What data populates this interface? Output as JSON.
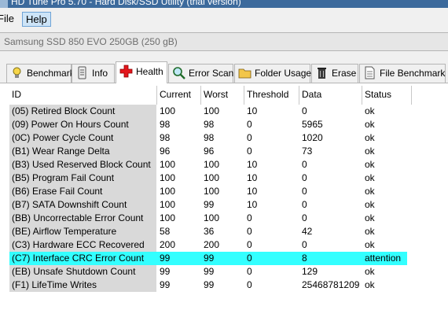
{
  "window": {
    "title": "HD Tune Pro 5.70 - Hard Disk/SSD Utility (trial version)"
  },
  "menu": {
    "file": "File",
    "help": "Help"
  },
  "drive": {
    "selected": "Samsung SSD 850 EVO 250GB (250 gB)"
  },
  "tabs": [
    {
      "label": "Benchmark",
      "icon": "lightbulb-icon"
    },
    {
      "label": "Info",
      "icon": "info-icon"
    },
    {
      "label": "Health",
      "icon": "health-cross-icon",
      "active": true
    },
    {
      "label": "Error Scan",
      "icon": "magnifier-icon"
    },
    {
      "label": "Folder Usage",
      "icon": "folder-icon"
    },
    {
      "label": "Erase",
      "icon": "trash-icon"
    },
    {
      "label": "File Benchmark",
      "icon": "file-icon"
    }
  ],
  "table": {
    "columns": [
      "ID",
      "Current",
      "Worst",
      "Threshold",
      "Data",
      "Status"
    ],
    "rows": [
      [
        "(05) Retired Block Count",
        "100",
        "100",
        "10",
        "0",
        "ok"
      ],
      [
        "(09) Power On Hours Count",
        "98",
        "98",
        "0",
        "5965",
        "ok"
      ],
      [
        "(0C) Power Cycle Count",
        "98",
        "98",
        "0",
        "1020",
        "ok"
      ],
      [
        "(B1) Wear Range Delta",
        "96",
        "96",
        "0",
        "73",
        "ok"
      ],
      [
        "(B3) Used Reserved Block Count",
        "100",
        "100",
        "10",
        "0",
        "ok"
      ],
      [
        "(B5) Program Fail Count",
        "100",
        "100",
        "10",
        "0",
        "ok"
      ],
      [
        "(B6) Erase Fail Count",
        "100",
        "100",
        "10",
        "0",
        "ok"
      ],
      [
        "(B7) SATA Downshift Count",
        "100",
        "99",
        "10",
        "0",
        "ok"
      ],
      [
        "(BB) Uncorrectable Error Count",
        "100",
        "100",
        "0",
        "0",
        "ok"
      ],
      [
        "(BE) Airflow Temperature",
        "58",
        "36",
        "0",
        "42",
        "ok"
      ],
      [
        "(C3) Hardware ECC Recovered",
        "200",
        "200",
        "0",
        "0",
        "ok"
      ],
      [
        "(C7) Interface CRC Error Count",
        "99",
        "99",
        "0",
        "8",
        "attention"
      ],
      [
        "(EB) Unsafe Shutdown Count",
        "99",
        "99",
        "0",
        "129",
        "ok"
      ],
      [
        "(F1) LifeTime Writes",
        "99",
        "99",
        "0",
        "25468781209",
        "ok"
      ]
    ],
    "highlight_row": 11,
    "highlight_color": "#33ffff"
  }
}
